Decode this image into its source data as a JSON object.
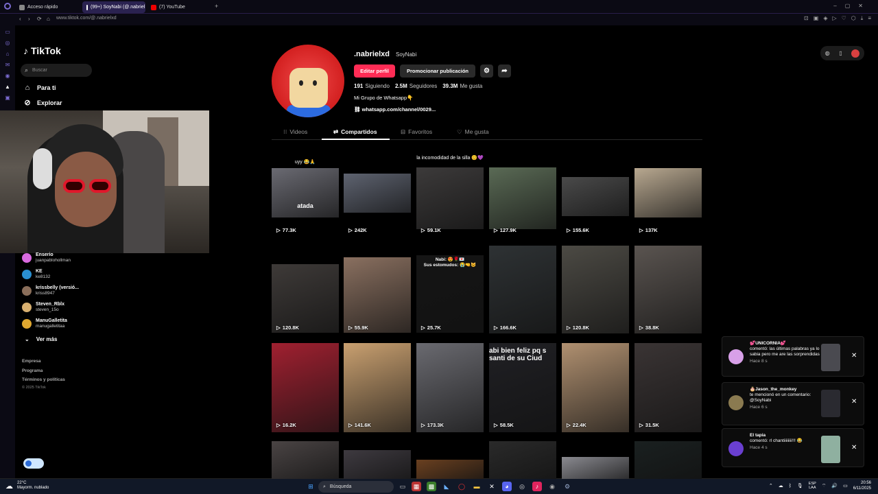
{
  "browser": {
    "tabs": [
      {
        "label": "Acceso rápido",
        "active": false
      },
      {
        "label": "(99+) SoyNabi (@.nabriel",
        "active": true
      },
      {
        "label": "(7) YouTube",
        "active": false
      }
    ],
    "new_tab": "+",
    "url": "www.tiktok.com/@.nabrielxd"
  },
  "sidebar": {
    "logo": "TikTok",
    "search_placeholder": "Buscar",
    "nav": [
      {
        "label": "Para ti",
        "icon": "home-icon"
      },
      {
        "label": "Explorar",
        "icon": "compass-icon"
      }
    ],
    "following": [
      {
        "name": "Enserio",
        "user": "juanpablohollman",
        "color": "#d96adf"
      },
      {
        "name": "KE",
        "user": "ke8132",
        "color": "#2a8fd0"
      },
      {
        "name": "krissbelly (versió...",
        "user": "kriss8947",
        "color": "#8a6e5a"
      },
      {
        "name": "Steven_Rblx",
        "user": "steven_15o",
        "color": "#d8b070"
      },
      {
        "name": "ManuGalletita",
        "user": "manugalletitaa",
        "color": "#e0a830"
      }
    ],
    "see_more": "Ver más",
    "footer": [
      "Empresa",
      "Programa",
      "Términos y políticas"
    ],
    "copyright": "© 2025 TikTok"
  },
  "profile": {
    "handle": ".nabrielxd",
    "display_name": "SoyNabi",
    "edit_button": "Editar perfil",
    "promote_button": "Promocionar publicación",
    "stats": [
      {
        "value": "191",
        "label": "Siguiendo"
      },
      {
        "value": "2.5M",
        "label": "Seguidores"
      },
      {
        "value": "39.3M",
        "label": "Me gusta"
      }
    ],
    "bio": "Mi Grupo de Whatsapp👇",
    "link": "whatsapp.com/channel/0029...",
    "tabs": [
      {
        "label": "Videos",
        "icon": "grid-icon"
      },
      {
        "label": "Compartidos",
        "icon": "repost-icon"
      },
      {
        "label": "Favoritos",
        "icon": "bookmark-icon"
      },
      {
        "label": "Me gusta",
        "icon": "heart-icon"
      }
    ],
    "active_tab": "Compartidos"
  },
  "videos": [
    {
      "views": "77.3K",
      "caption": "uyy 😂🙏",
      "overlay": "atada",
      "color": "#6a6a72"
    },
    {
      "views": "242K",
      "caption": "",
      "overlay": "",
      "color": "#5e6370"
    },
    {
      "views": "59.1K",
      "caption": "la incomodidad de la silla 😊💜",
      "overlay": "",
      "color": "#3c3a3a"
    },
    {
      "views": "127.9K",
      "caption": "",
      "overlay": "",
      "color": "#5a6a55"
    },
    {
      "views": "155.6K",
      "caption": "",
      "overlay": "",
      "color": "#4a4a4a"
    },
    {
      "views": "137K",
      "caption": "",
      "overlay": "",
      "color": "#b8a890"
    },
    {
      "views": "120.8K",
      "caption": "",
      "overlay": "",
      "color": "#3e3a38"
    },
    {
      "views": "55.9K",
      "caption": "",
      "overlay": "",
      "color": "#8a7060"
    },
    {
      "views": "25.7K",
      "caption": "",
      "overlay": "Nabi: 😍🌹💌\nSus estomudos: 😭🤜😺",
      "color": "#151515"
    },
    {
      "views": "166.6K",
      "caption": "",
      "overlay": "",
      "color": "#2e3234"
    },
    {
      "views": "120.8K",
      "caption": "",
      "overlay": "",
      "color": "#4c4a44"
    },
    {
      "views": "38.8K",
      "caption": "",
      "overlay": "",
      "color": "#5a5450"
    },
    {
      "views": "16.2K",
      "caption": "",
      "overlay": "",
      "color": "#a02030"
    },
    {
      "views": "141.6K",
      "caption": "",
      "overlay": "",
      "color": "#c9a070"
    },
    {
      "views": "173.3K",
      "caption": "",
      "overlay": "",
      "color": "#6a6a70"
    },
    {
      "views": "58.5K",
      "caption": "",
      "overlay": "abi bien feliz pq s santi de su Ciud",
      "color": "#202024"
    },
    {
      "views": "22.4K",
      "caption": "",
      "overlay": "",
      "color": "#b09070"
    },
    {
      "views": "31.5K",
      "caption": "",
      "overlay": "",
      "color": "#3a3434"
    },
    {
      "views": "",
      "caption": "",
      "overlay": "",
      "color": "#4a4444"
    },
    {
      "views": "",
      "caption": "",
      "overlay": "",
      "color": "#3e3a40"
    },
    {
      "views": "",
      "caption": "",
      "overlay": "",
      "color": "#6a4020"
    },
    {
      "views": "",
      "caption": "",
      "overlay": "",
      "color": "#2a2a2a"
    },
    {
      "views": "",
      "caption": "",
      "overlay": "",
      "color": "#8a8a90"
    },
    {
      "views": "",
      "caption": "",
      "overlay": "",
      "color": "#1a2020"
    }
  ],
  "notifications": [
    {
      "user": "💕UNICORNIA💕",
      "text": "comentó: las últimas palabras ya lo sabia pero me are las sorprendidas 😂",
      "ago": "Hace 8 s",
      "color": "#d8a0e8"
    },
    {
      "user": "🎂Jason_the_monkey",
      "text": "te mencionó en un comentario: @SoyNabi",
      "ago": "Hace 6 s",
      "color": "#8a7a50"
    },
    {
      "user": "El tapia",
      "text": "comentó: rl chantiiiiiiii!!! 😂",
      "ago": "Hace 4 s",
      "color": "#6a3fd0"
    }
  ],
  "taskbar": {
    "temp": "22°C",
    "weather": "Mayorm. nublado",
    "search": "Búsqueda",
    "lang_top": "ESP",
    "lang_bottom": "LAA",
    "time": "20:56",
    "date": "6/11/2025"
  }
}
